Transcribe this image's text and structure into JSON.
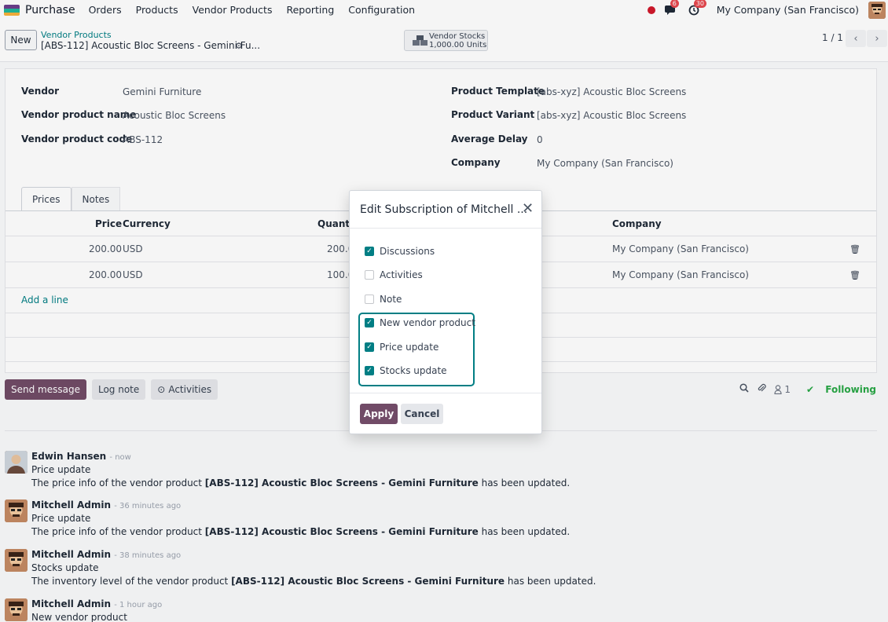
{
  "topbar": {
    "app_name": "Purchase",
    "menu": [
      "Orders",
      "Products",
      "Vendor Products",
      "Reporting",
      "Configuration"
    ],
    "messages_badge": "6",
    "activities_badge": "30",
    "company": "My Company (San Francisco)"
  },
  "control_panel": {
    "new_label": "New",
    "breadcrumb_parent": "Vendor Products",
    "breadcrumb_current": "[ABS-112] Acoustic Bloc Screens - Gemini Fu...",
    "stat_label": "Vendor Stocks",
    "stat_value": "1,000.00 Units",
    "pager": "1 / 1"
  },
  "form": {
    "left": [
      {
        "label": "Vendor",
        "value": "Gemini Furniture"
      },
      {
        "label": "Vendor product name",
        "value": "Acoustic Bloc Screens"
      },
      {
        "label": "Vendor product code",
        "value": "ABS-112"
      }
    ],
    "right": [
      {
        "label": "Product Template",
        "value": "[abs-xyz] Acoustic Bloc Screens"
      },
      {
        "label": "Product Variant",
        "value": "[abs-xyz] Acoustic Bloc Screens"
      },
      {
        "label": "Average Delay",
        "value": "0"
      },
      {
        "label": "Company",
        "value": "My Company (San Francisco)"
      }
    ],
    "tabs": [
      "Prices",
      "Notes"
    ],
    "columns": {
      "price": "Price",
      "currency": "Currency",
      "quantity": "Quantit",
      "company": "Company"
    },
    "rows": [
      {
        "price": "200.00",
        "currency": "USD",
        "quantity": "200.0",
        "company": "My Company (San Francisco)"
      },
      {
        "price": "200.00",
        "currency": "USD",
        "quantity": "100.0",
        "company": "My Company (San Francisco)"
      }
    ],
    "add_line": "Add a line"
  },
  "chatter": {
    "send_message": "Send message",
    "log_note": "Log note",
    "activities": "Activities",
    "followers_count": "1",
    "following": "Following",
    "messages": [
      {
        "author": "Edwin Hansen",
        "time": "- now",
        "subject": "Price update",
        "body_pre": "The price info of the vendor product ",
        "body_bold": "[ABS-112] Acoustic Bloc Screens - Gemini Furniture",
        "body_post": " has been updated."
      },
      {
        "author": "Mitchell Admin",
        "time": "- 36 minutes ago",
        "subject": "Price update",
        "body_pre": "The price info of the vendor product ",
        "body_bold": "[ABS-112] Acoustic Bloc Screens - Gemini Furniture",
        "body_post": " has been updated."
      },
      {
        "author": "Mitchell Admin",
        "time": "- 38 minutes ago",
        "subject": "Stocks update",
        "body_pre": "The inventory level of the vendor product ",
        "body_bold": "[ABS-112] Acoustic Bloc Screens - Gemini Furniture",
        "body_post": " has been updated."
      },
      {
        "author": "Mitchell Admin",
        "time": "- 1 hour ago",
        "subject": "New vendor product",
        "body_pre": "",
        "body_bold": "",
        "body_post": ""
      }
    ]
  },
  "dialog": {
    "title": "Edit Subscription of Mitchell ...",
    "options": [
      {
        "label": "Discussions",
        "checked": true
      },
      {
        "label": "Activities",
        "checked": false
      },
      {
        "label": "Note",
        "checked": false
      },
      {
        "label": "New vendor product",
        "checked": true
      },
      {
        "label": "Price update",
        "checked": true
      },
      {
        "label": "Stocks update",
        "checked": true
      }
    ],
    "apply": "Apply",
    "cancel": "Cancel"
  },
  "colors": {
    "primary": "#714b67",
    "accent": "#017e84",
    "following": "#28a745",
    "badge": "#e7484f"
  }
}
